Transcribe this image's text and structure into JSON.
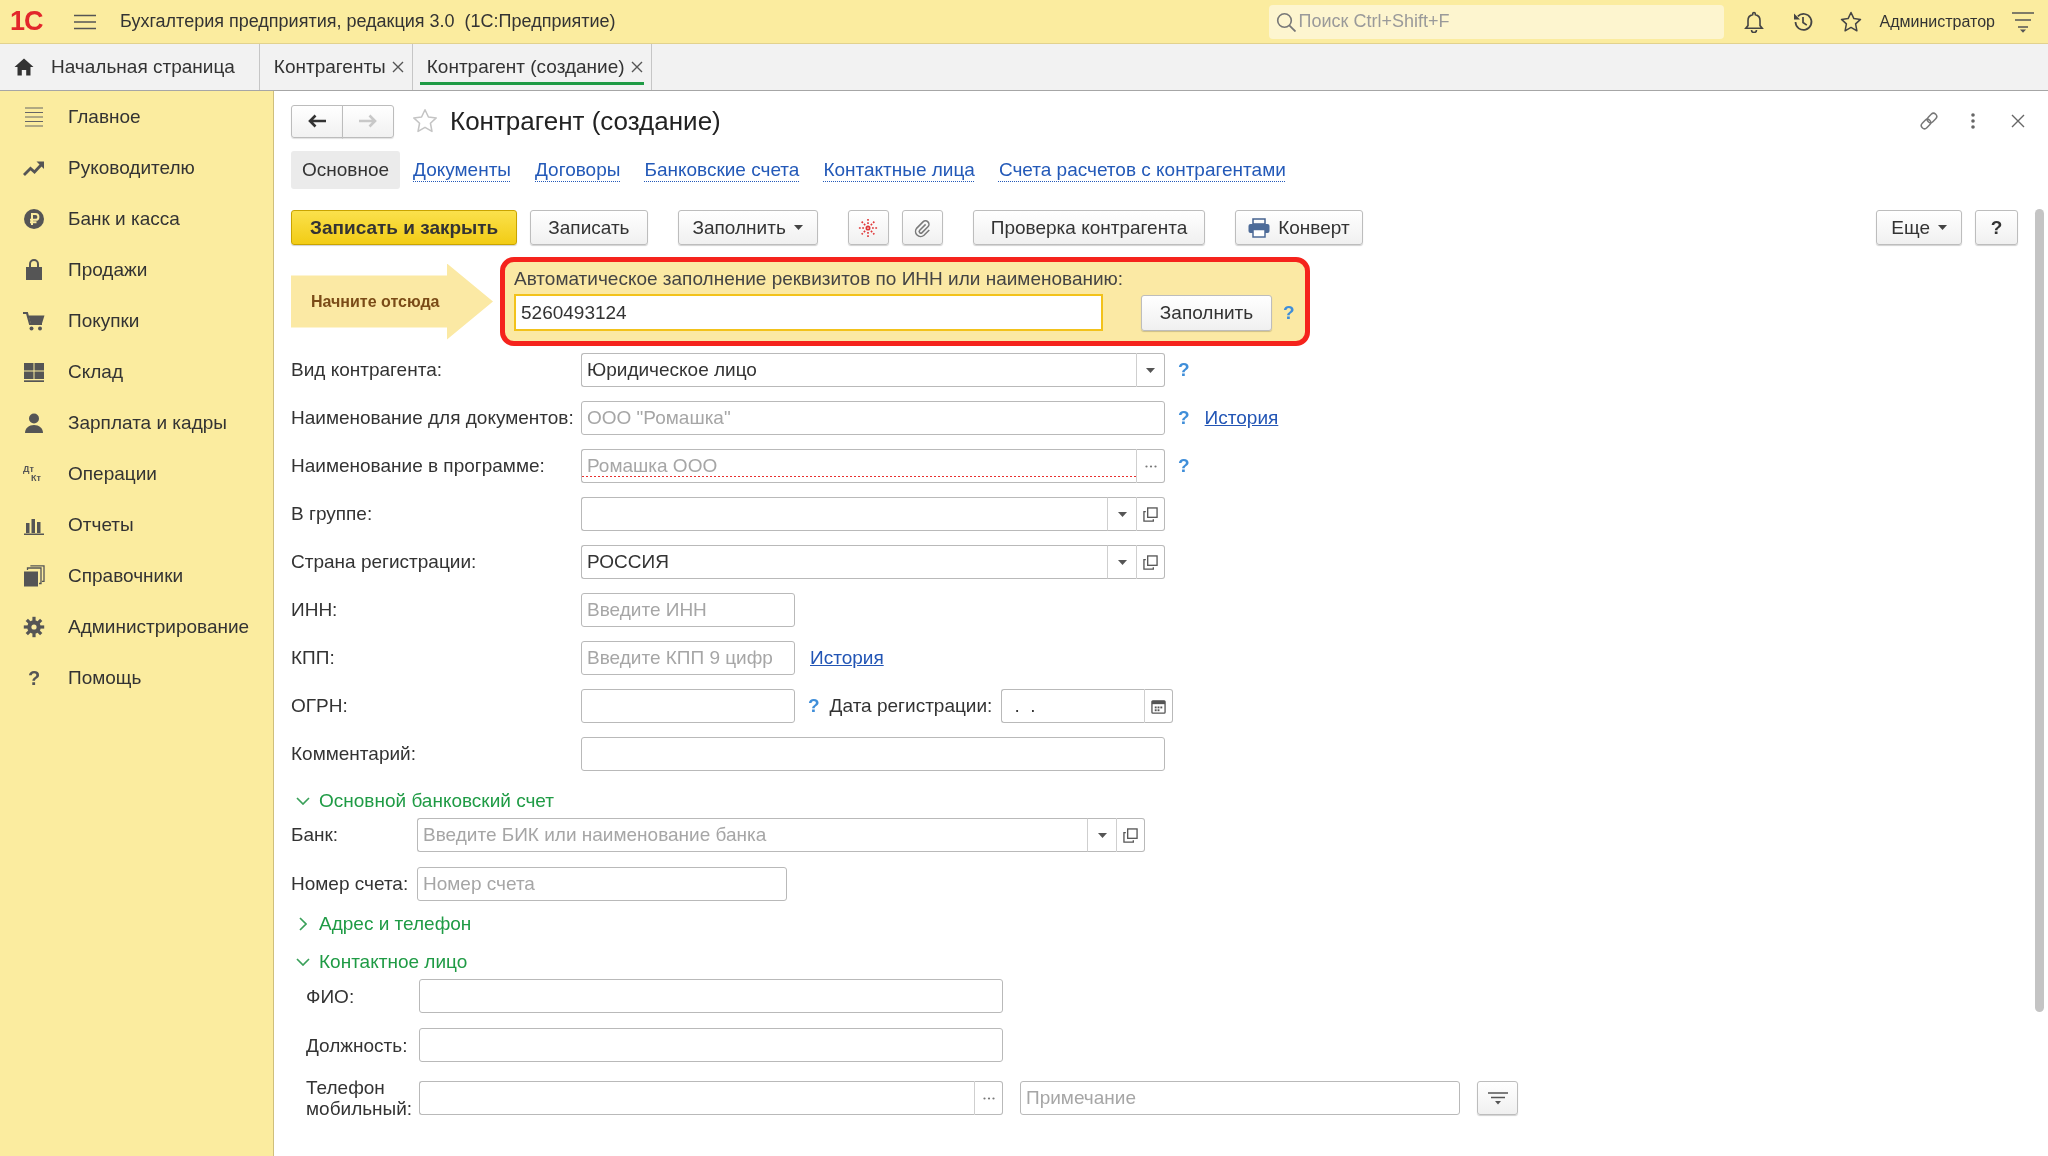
{
  "app_bar": {
    "logo": "1С",
    "title": "Бухгалтерия предприятия, редакция 3.0  (1С:Предприятие)",
    "search": {
      "placeholder": "Поиск Ctrl+Shift+F"
    },
    "user": "Администратор"
  },
  "open_tabs": [
    {
      "label": "Начальная страница",
      "kind": "home",
      "selected": false
    },
    {
      "label": "Контрагенты",
      "kind": "document",
      "selected": false
    },
    {
      "label": "Контрагент (создание)",
      "kind": "document",
      "selected": true
    }
  ],
  "sidebar": {
    "items": [
      {
        "label": "Главное"
      },
      {
        "label": "Руководителю"
      },
      {
        "label": "Банк и касса"
      },
      {
        "label": "Продажи"
      },
      {
        "label": "Покупки"
      },
      {
        "label": "Склад"
      },
      {
        "label": "Зарплата и кадры"
      },
      {
        "label": "Операции",
        "glyph": [
          "Дт",
          "Кт"
        ]
      },
      {
        "label": "Отчеты"
      },
      {
        "label": "Справочники"
      },
      {
        "label": "Администрирование"
      },
      {
        "label": "Помощь",
        "glyph": [
          "?"
        ]
      }
    ]
  },
  "form": {
    "title": "Контрагент (создание)",
    "back_disabled": false,
    "forward_disabled": true,
    "tabs": [
      {
        "label": "Основное",
        "selected": true
      },
      {
        "label": "Документы",
        "selected": false
      },
      {
        "label": "Договоры",
        "selected": false
      },
      {
        "label": "Банковские счета",
        "selected": false
      },
      {
        "label": "Контактные лица",
        "selected": false
      },
      {
        "label": "Счета расчетов с контрагентами",
        "selected": false
      }
    ],
    "toolbar": {
      "left": [
        [
          {
            "kind": "primary",
            "label": "Записать и закрыть"
          },
          {
            "kind": "button",
            "label": "Записать"
          }
        ],
        [
          {
            "kind": "menu",
            "label": "Заполнить"
          }
        ],
        [
          {
            "kind": "icon"
          },
          {
            "kind": "icon"
          }
        ],
        [
          {
            "kind": "button",
            "label": "Проверка контрагента"
          }
        ],
        [
          {
            "kind": "print",
            "label": "Конверт"
          }
        ]
      ],
      "right": [
        [
          {
            "kind": "menu",
            "label": "Еще"
          },
          {
            "kind": "help",
            "label": "?"
          }
        ]
      ]
    },
    "autofill": {
      "hint": "Начните отсюда",
      "label": "Автоматическое заполнение реквизитов по ИНН или наименованию:",
      "value": "5260493124",
      "button": "Заполнить",
      "help": "?"
    },
    "fields": [
      {
        "kind": "select",
        "label": "Вид контрагента:",
        "value": "Юридическое лицо",
        "help": "?"
      },
      {
        "kind": "input",
        "label": "Наименование для документов:",
        "placeholder": "ООО \"Ромашка\"",
        "help": "?",
        "link": "История"
      },
      {
        "kind": "choice",
        "label": "Наименование в программе:",
        "placeholder": "Ромашка ООО",
        "help": "?",
        "required": true
      },
      {
        "kind": "select_open",
        "label": "В группе:"
      },
      {
        "kind": "select_open",
        "label": "Страна регистрации:",
        "value": "РОССИЯ"
      },
      {
        "kind": "short",
        "label": "ИНН:",
        "placeholder": "Введите ИНН"
      },
      {
        "kind": "short",
        "label": "КПП:",
        "placeholder": "Введите КПП 9 цифр",
        "link": "История"
      },
      {
        "kind": "short",
        "label": "ОГРН:",
        "help": "?",
        "date": {
          "label": "Дата регистрации:",
          "value": ".  ."
        }
      },
      {
        "kind": "input",
        "label": "Комментарий:"
      }
    ],
    "groups": [
      {
        "title": "Основной банковский счет",
        "expanded": true,
        "fields": [
          {
            "kind": "select_open",
            "label": "Банк:",
            "placeholder": "Введите БИК или наименование банка"
          },
          {
            "kind": "short",
            "label": "Номер счета:",
            "placeholder": "Номер счета"
          }
        ]
      },
      {
        "title": "Адрес и телефон",
        "expanded": false
      },
      {
        "title": "Контактное лицо",
        "expanded": true,
        "fields": [
          {
            "kind": "input",
            "label": "ФИО:"
          },
          {
            "kind": "input",
            "label": "Должность:"
          },
          {
            "kind": "choice",
            "label": "Телефон мобильный:",
            "note": {
              "placeholder": "Примечание"
            }
          }
        ]
      }
    ]
  }
}
